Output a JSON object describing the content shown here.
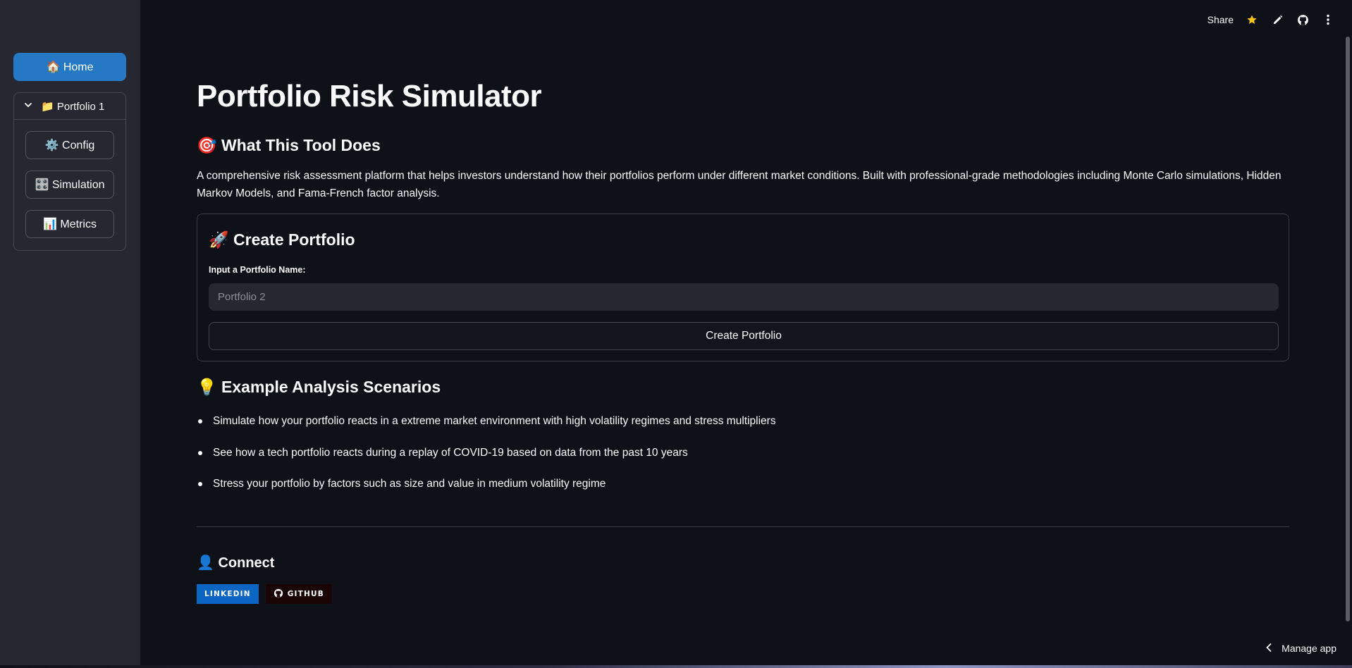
{
  "sidebar": {
    "home_label": "🏠 Home",
    "portfolio_expander": {
      "label": "📁 Portfolio 1",
      "items": [
        {
          "label": "⚙️ Config"
        },
        {
          "label": "🎛️ Simulation"
        },
        {
          "label": "📊 Metrics"
        }
      ]
    }
  },
  "toolbar": {
    "share_label": "Share",
    "icons": [
      "star-icon",
      "pencil-icon",
      "github-icon",
      "more-vertical-icon"
    ],
    "star_color": "#f5c518"
  },
  "main": {
    "title": "Portfolio Risk Simulator",
    "what_heading": "🎯 What This Tool Does",
    "description": "A comprehensive risk assessment platform that helps investors understand how their portfolios perform under different market conditions. Built with professional-grade methodologies including Monte Carlo simulations, Hidden Markov Models, and Fama-French factor analysis.",
    "create_card": {
      "heading": "🚀 Create Portfolio",
      "input_label": "Input a Portfolio Name:",
      "input_placeholder": "Portfolio 2",
      "button_label": "Create Portfolio"
    },
    "examples_heading": "💡 Example Analysis Scenarios",
    "examples": [
      "Simulate how your portfolio reacts in a extreme market environment with high volatility regimes and stress multipliers",
      "See how a tech portfolio reacts during a replay of COVID-19 based on data from the past 10 years",
      "Stress your portfolio by factors such as size and value in medium volatility regime"
    ],
    "connect_heading": "👤 Connect",
    "badges": {
      "linkedin": "LINKEDIN",
      "github": "GITHUB"
    }
  },
  "footer": {
    "manage_label": "Manage app"
  },
  "colors": {
    "background": "#0e1117",
    "sidebar": "#262730",
    "primary_button": "#2478c4",
    "linkedin": "#0a66c2"
  }
}
